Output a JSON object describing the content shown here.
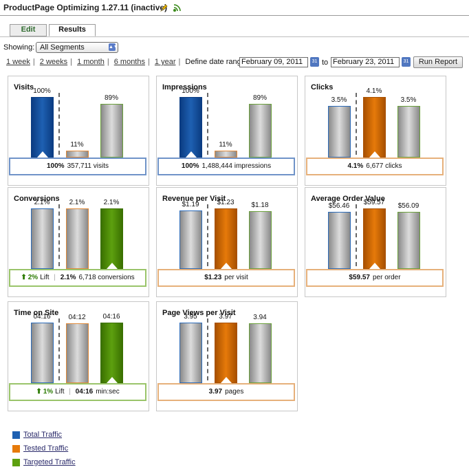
{
  "app": {
    "title": "ProductPage Optimizing 1.27.11 (inactive)",
    "icons": [
      "edit-icon",
      "activate-icon"
    ]
  },
  "tabs": {
    "edit": "Edit",
    "results": "Results"
  },
  "filter": {
    "showing_label": "Showing:",
    "segment_value": "All Segments"
  },
  "range": {
    "links": [
      "1 week",
      "2 weeks",
      "1 month",
      "6 months",
      "1 year"
    ],
    "define_label": "Define date range",
    "start_date": "February 09, 2011",
    "to_label": "to",
    "end_date": "February 23, 2011",
    "run_button": "Run Report"
  },
  "colors": {
    "total": "#1e60b2",
    "tested": "#e67a0a",
    "targeted": "#5da00f"
  },
  "metrics": [
    {
      "title": "Visits",
      "labels": [
        "100%",
        "11%",
        "89%"
      ],
      "levels": [
        100,
        11,
        89
      ],
      "highlight": "total",
      "summary_value": "100%",
      "summary_text": "357,711 visits"
    },
    {
      "title": "Impressions",
      "labels": [
        "100%",
        "11%",
        "89%"
      ],
      "levels": [
        100,
        11,
        89
      ],
      "highlight": "total",
      "summary_value": "100%",
      "summary_text": "1,488,444 impressions"
    },
    {
      "title": "Clicks",
      "labels": [
        "3.5%",
        "4.1%",
        "3.5%"
      ],
      "levels": [
        3.5,
        4.1,
        3.5
      ],
      "highlight": "tested",
      "summary_value": "4.1%",
      "summary_text": "6,677 clicks"
    },
    {
      "title": "Conversions",
      "labels": [
        "2.1%",
        "2.1%",
        "2.1%"
      ],
      "levels": [
        2.1,
        2.1,
        2.1
      ],
      "highlight": "targeted",
      "lift_value": "2%",
      "lift_label": "Lift",
      "summary_value": "2.1%",
      "summary_text": "6,718 conversions"
    },
    {
      "title": "Revenue per Visit",
      "labels": [
        "$1.19",
        "$1.23",
        "$1.18"
      ],
      "levels": [
        1.19,
        1.23,
        1.18
      ],
      "highlight": "tested",
      "summary_value": "$1.23",
      "summary_text": "per visit"
    },
    {
      "title": "Average Order Value",
      "labels": [
        "$56.46",
        "$59.57",
        "$56.09"
      ],
      "levels": [
        56.46,
        59.57,
        56.09
      ],
      "highlight": "tested",
      "summary_value": "$59.57",
      "summary_text": "per order"
    },
    {
      "title": "Time on Site",
      "labels": [
        "04:16",
        "04:12",
        "04:16"
      ],
      "levels": [
        256,
        252,
        256
      ],
      "highlight": "targeted",
      "lift_value": "1%",
      "lift_label": "Lift",
      "summary_value": "04:16",
      "summary_text": "min:sec"
    },
    {
      "title": "Page Views per Visit",
      "labels": [
        "3.95",
        "3.97",
        "3.94"
      ],
      "levels": [
        3.95,
        3.97,
        3.94
      ],
      "highlight": "tested",
      "summary_value": "3.97",
      "summary_text": "pages"
    }
  ],
  "legend": [
    "Total Traffic",
    "Tested Traffic",
    "Targeted Traffic"
  ]
}
